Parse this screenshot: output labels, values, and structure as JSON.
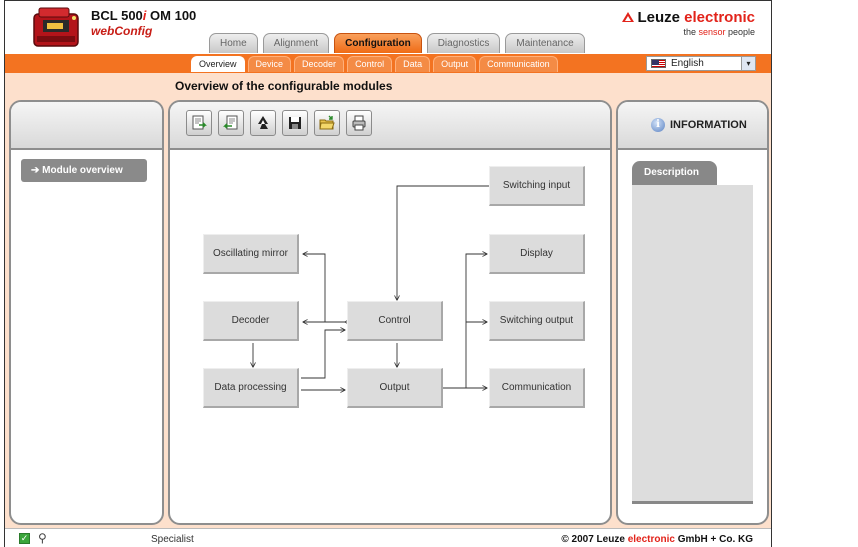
{
  "header": {
    "product_title_a": "BCL 500",
    "product_title_i": "i",
    "product_title_b": " OM 100",
    "app_name": "webConfig",
    "brand_dark": "Leuze ",
    "brand_red": "electronic",
    "brand_tag_a": "the ",
    "brand_tag_red": "sensor",
    "brand_tag_b": " people"
  },
  "main_tabs": [
    {
      "label": "Home",
      "active": false
    },
    {
      "label": "Alignment",
      "active": false
    },
    {
      "label": "Configuration",
      "active": true
    },
    {
      "label": "Diagnostics",
      "active": false
    },
    {
      "label": "Maintenance",
      "active": false
    }
  ],
  "sub_tabs": [
    {
      "label": "Overview",
      "active": true
    },
    {
      "label": "Device",
      "active": false
    },
    {
      "label": "Decoder",
      "active": false
    },
    {
      "label": "Control",
      "active": false
    },
    {
      "label": "Data",
      "active": false
    },
    {
      "label": "Output",
      "active": false
    },
    {
      "label": "Communication",
      "active": false
    }
  ],
  "language": {
    "selected": "English",
    "arrow": "▾"
  },
  "page_title": "Overview of the configurable modules",
  "left_panel": {
    "module_overview": "➔ Module overview"
  },
  "toolbar": [
    {
      "name": "upload-to-device-icon"
    },
    {
      "name": "download-from-device-icon"
    },
    {
      "name": "recycle-reset-icon"
    },
    {
      "name": "save-icon"
    },
    {
      "name": "open-folder-icon"
    },
    {
      "name": "print-icon"
    }
  ],
  "diagram": {
    "nodes": {
      "switching_input": "Switching input",
      "oscillating_mirror": "Oscillating mirror",
      "display": "Display",
      "decoder": "Decoder",
      "control": "Control",
      "switching_output": "Switching output",
      "data_processing": "Data processing",
      "output": "Output",
      "communication": "Communication"
    }
  },
  "info": {
    "title": "INFORMATION",
    "icon": "i",
    "description_tab": "Description"
  },
  "footer": {
    "user_level": "Specialist",
    "copyright_a": "© 2007 Leuze ",
    "copyright_red": "electronic",
    "copyright_b": " GmbH + Co. KG"
  },
  "colors": {
    "accent": "#f37321",
    "brand_red": "#e2231a",
    "panel_bg": "#fde0cc"
  }
}
